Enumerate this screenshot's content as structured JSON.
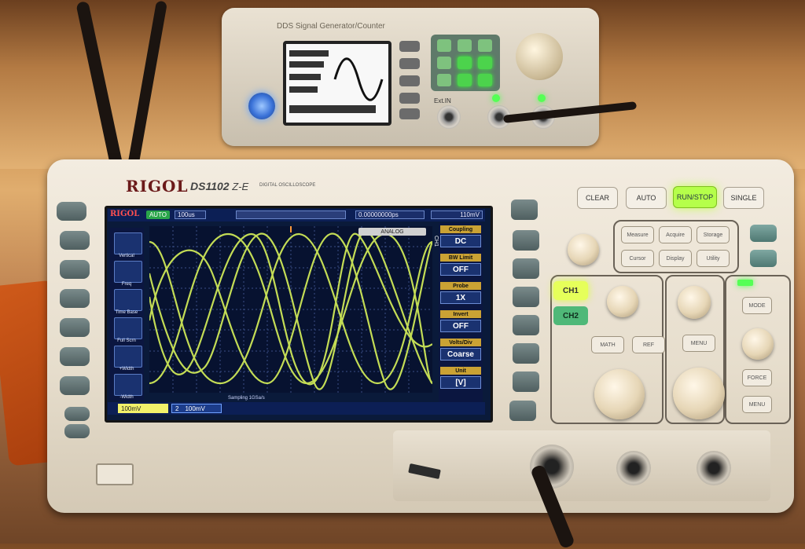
{
  "function_generator": {
    "title": "DDS Signal Generator/Counter",
    "input_label": "Ext.IN"
  },
  "oscilloscope": {
    "brand": "RIGOL",
    "model": "DS1102",
    "series": "Z-E",
    "series_sub": "DIGITAL OSCILLOSCOPE",
    "top_keys": [
      "CLEAR",
      "AUTO",
      "RUN/STOP",
      "SINGLE"
    ],
    "menu_keys": [
      "Measure",
      "Acquire",
      "Storage",
      "Cursor",
      "Display",
      "Utility"
    ],
    "channel_buttons": [
      "CH1",
      "CH2"
    ],
    "function_keys": [
      "MATH",
      "REF",
      "MENU",
      "MODE",
      "FORCE",
      "MENU"
    ],
    "screen": {
      "mode_badge": "AUTO",
      "logo": "RIGOL",
      "timebase": "100us",
      "delay": "0.00000000ps",
      "trigger": "110mV",
      "trigger_label": "ANALOG",
      "left_menu": [
        "Vertical",
        "Freq",
        "Time Base",
        "Full Scrn",
        "+Width",
        "-Width"
      ],
      "right_menu_title": "CH1",
      "right_menu": [
        {
          "title": "Coupling",
          "value": "DC"
        },
        {
          "title": "BW Limit",
          "value": "OFF"
        },
        {
          "title": "Probe",
          "value": "1X"
        },
        {
          "title": "Invert",
          "value": "OFF"
        },
        {
          "title": "Volts/Div",
          "value": "Coarse"
        },
        {
          "title": "Unit",
          "value": "[V]"
        }
      ],
      "ch1_scale": "100mV",
      "ch2_number": "2",
      "ch2_scale": "100mV",
      "status_line": "Sampling 1GSa/s"
    }
  },
  "colors": {
    "trace": "#d8f25a",
    "screen_bg": "#0a1a3a",
    "lit_key": "#b5ff4a"
  }
}
